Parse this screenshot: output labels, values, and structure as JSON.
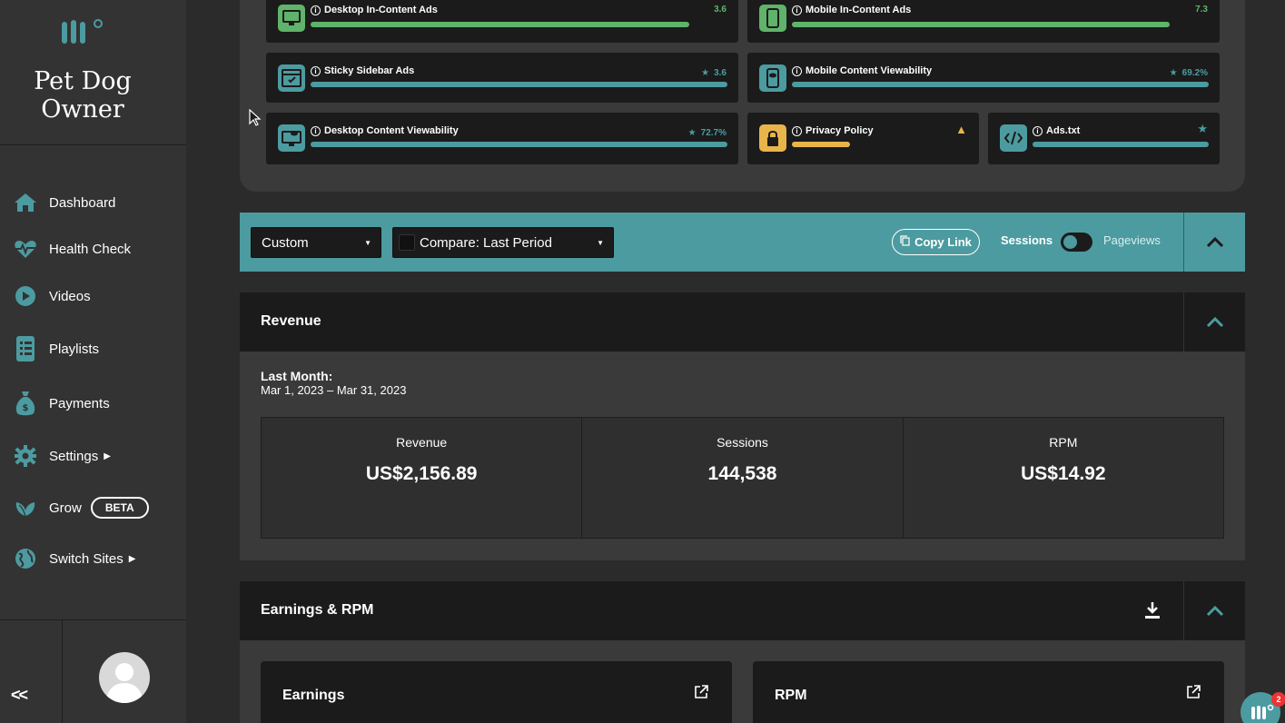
{
  "sidebar": {
    "site_name_line1": "Pet Dog",
    "site_name_line2": "Owner",
    "items": [
      {
        "label": "Dashboard",
        "icon": "home-icon"
      },
      {
        "label": "Health Check",
        "icon": "heartbeat-icon"
      },
      {
        "label": "Videos",
        "icon": "play-icon"
      },
      {
        "label": "Playlists",
        "icon": "list-icon"
      },
      {
        "label": "Payments",
        "icon": "money-bag-icon"
      },
      {
        "label": "Settings",
        "icon": "gear-icon"
      },
      {
        "label": "Grow",
        "icon": "leaf-icon",
        "badge": "BETA"
      },
      {
        "label": "Switch Sites",
        "icon": "globe-icon"
      }
    ],
    "collapse_label": "<<"
  },
  "health_cards": [
    {
      "title": "Desktop In-Content Ads",
      "score": "3.6",
      "bar_fraction": 0.91,
      "color": "#5fb36a",
      "icon": "desktop-icon"
    },
    {
      "title": "Mobile In-Content Ads",
      "score": "7.3",
      "bar_fraction": 0.91,
      "color": "#5fb36a",
      "icon": "mobile-icon"
    },
    {
      "title": "Sticky Sidebar Ads",
      "score": "3.6",
      "bar_fraction": 1.0,
      "color": "#4c9ba0",
      "icon": "sidebar-ad-icon"
    },
    {
      "title": "Mobile Content Viewability",
      "score": "69.2%",
      "bar_fraction": 1.0,
      "color": "#4c9ba0",
      "icon": "mobile-eye-icon"
    },
    {
      "title": "Desktop Content Viewability",
      "score": "72.7%",
      "bar_fraction": 1.0,
      "color": "#4c9ba0",
      "icon": "desktop-eye-icon"
    },
    {
      "title": "Privacy Policy",
      "score": "",
      "bar_fraction": 0.35,
      "color": "#e8b54a",
      "icon": "lock-icon"
    },
    {
      "title": "Ads.txt",
      "score": "",
      "bar_fraction": 1.0,
      "color": "#4c9ba0",
      "icon": "code-icon"
    }
  ],
  "filters": {
    "date_range": "Custom",
    "compare": "Compare: Last Period",
    "copy_link": "Copy Link",
    "toggle_left": "Sessions",
    "toggle_right": "Pageviews"
  },
  "revenue": {
    "title": "Revenue",
    "period_label": "Last Month:",
    "period_range": "Mar 1, 2023 – Mar 31, 2023",
    "stats": [
      {
        "label": "Revenue",
        "value": "US$2,156.89"
      },
      {
        "label": "Sessions",
        "value": "144,538"
      },
      {
        "label": "RPM",
        "value": "US$14.92"
      }
    ]
  },
  "earnings": {
    "title": "Earnings & RPM",
    "cards": [
      "Earnings",
      "RPM"
    ]
  },
  "chat": {
    "badge": "2"
  },
  "colors": {
    "accent": "#4c9ba0",
    "green": "#5fb36a",
    "warning": "#e8b54a"
  }
}
